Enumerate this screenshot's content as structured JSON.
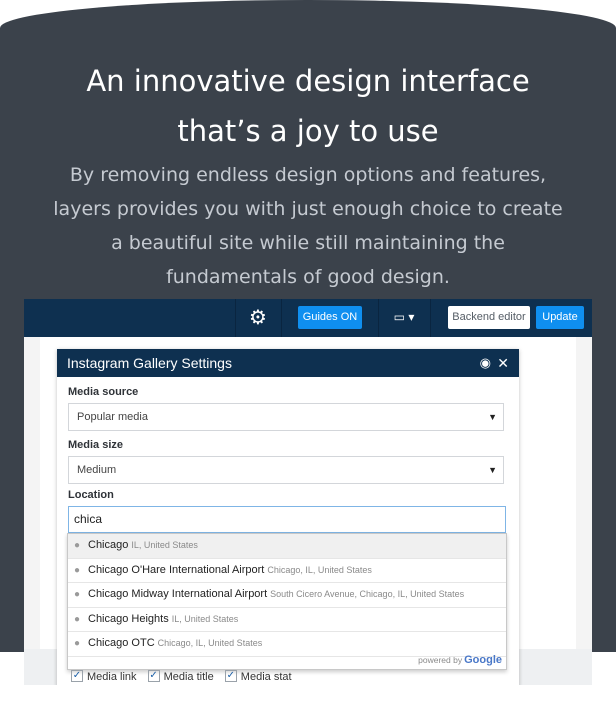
{
  "hero": {
    "title_line1": "An innovative design interface",
    "title_line2": "that’s a joy to use",
    "sub_line1": "By removing endless design options and features,",
    "sub_line2": "layers provides you with just enough choice to create",
    "sub_line3": "a beautiful site while still maintaining the",
    "sub_line4": "fundamentals of good design."
  },
  "toolbar": {
    "settings_icon": "gear-icon",
    "guides_label": "Guides ON",
    "device_icon": "▭ ▾",
    "backend_label": "Backend editor",
    "update_label": "Update"
  },
  "panel": {
    "title": "Instagram Gallery Settings",
    "eye_icon": "◉",
    "close_icon": "✕",
    "media_source_label": "Media source",
    "media_source_value": "Popular media",
    "media_size_label": "Media size",
    "media_size_value": "Medium",
    "location_label": "Location",
    "location_value": "chica"
  },
  "autocomplete": {
    "items": [
      {
        "main": "Chicago",
        "sub": "IL, United States"
      },
      {
        "main": "Chicago O'Hare International Airport",
        "sub": "Chicago, IL, United States"
      },
      {
        "main": "Chicago Midway International Airport",
        "sub": "South Cicero Avenue, Chicago, IL, United States"
      },
      {
        "main": "Chicago Heights",
        "sub": "IL, United States"
      },
      {
        "main": "Chicago OTC",
        "sub": "Chicago, IL, United States"
      }
    ],
    "powered_by": "powered by",
    "google": "Google"
  },
  "checkboxes": [
    {
      "label": "Media link",
      "checked": true
    },
    {
      "label": "Media title",
      "checked": true
    },
    {
      "label": "Media stat",
      "checked": true
    }
  ],
  "colors": {
    "banner": "#3b424b",
    "toolbar": "#0e3050",
    "accent": "#0f8ff0"
  }
}
